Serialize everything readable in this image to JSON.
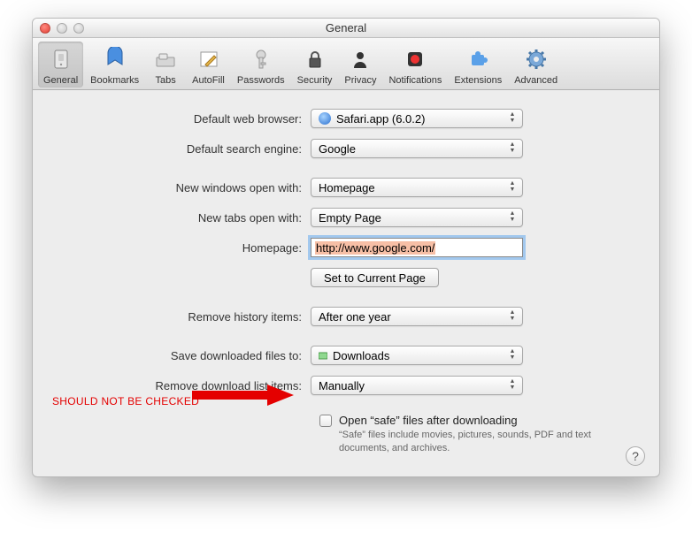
{
  "window": {
    "title": "General"
  },
  "toolbar": [
    {
      "label": "General",
      "icon": "switch",
      "selected": true
    },
    {
      "label": "Bookmarks",
      "icon": "book"
    },
    {
      "label": "Tabs",
      "icon": "tabs"
    },
    {
      "label": "AutoFill",
      "icon": "pencil"
    },
    {
      "label": "Passwords",
      "icon": "key"
    },
    {
      "label": "Security",
      "icon": "lock"
    },
    {
      "label": "Privacy",
      "icon": "person"
    },
    {
      "label": "Notifications",
      "icon": "bell"
    },
    {
      "label": "Extensions",
      "icon": "puzzle"
    },
    {
      "label": "Advanced",
      "icon": "gear"
    }
  ],
  "form": {
    "default_browser": {
      "label": "Default web browser:",
      "value": "Safari.app (6.0.2)"
    },
    "default_engine": {
      "label": "Default search engine:",
      "value": "Google"
    },
    "new_windows": {
      "label": "New windows open with:",
      "value": "Homepage"
    },
    "new_tabs": {
      "label": "New tabs open with:",
      "value": "Empty Page"
    },
    "homepage": {
      "label": "Homepage:",
      "value": "http://www.google.com/"
    },
    "set_current": "Set to Current Page",
    "remove_history": {
      "label": "Remove history items:",
      "value": "After one year"
    },
    "save_to": {
      "label": "Save downloaded files to:",
      "value": "Downloads"
    },
    "remove_downloads": {
      "label": "Remove download list items:",
      "value": "Manually"
    },
    "open_safe": {
      "title": "Open “safe” files after downloading",
      "desc": "“Safe” files include movies, pictures, sounds, PDF and text documents, and archives."
    }
  },
  "annotation": "SHOULD NOT BE CHECKED"
}
